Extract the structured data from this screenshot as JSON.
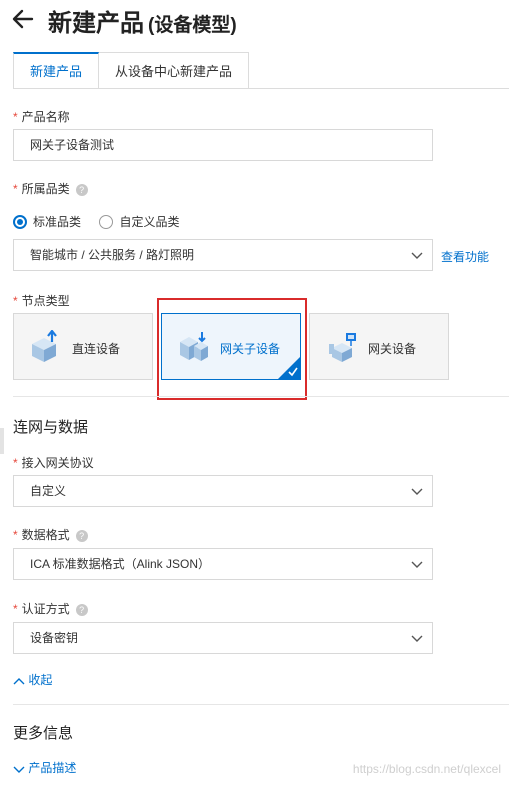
{
  "header": {
    "title": "新建产品",
    "subtitle": "(设备模型)"
  },
  "tabs": [
    {
      "label": "新建产品"
    },
    {
      "label": "从设备中心新建产品"
    }
  ],
  "form": {
    "product_name": {
      "label": "产品名称",
      "value": "网关子设备测试"
    },
    "category": {
      "label": "所属品类",
      "options": [
        {
          "label": "标准品类",
          "selected": true
        },
        {
          "label": "自定义品类",
          "selected": false
        }
      ],
      "select_value": "智能城市 / 公共服务 / 路灯照明",
      "link": "查看功能"
    },
    "node_type": {
      "label": "节点类型",
      "cards": [
        {
          "label": "直连设备",
          "selected": false
        },
        {
          "label": "网关子设备",
          "selected": true
        },
        {
          "label": "网关设备",
          "selected": false
        }
      ]
    }
  },
  "network": {
    "title": "连网与数据",
    "protocol": {
      "label": "接入网关协议",
      "value": "自定义"
    },
    "data_format": {
      "label": "数据格式",
      "value": "ICA 标准数据格式（Alink JSON）"
    },
    "auth": {
      "label": "认证方式",
      "value": "设备密钥"
    },
    "collapse": "收起"
  },
  "more": {
    "title": "更多信息",
    "desc_toggle": "产品描述"
  },
  "watermark": "https://blog.csdn.net/qlexcel",
  "colors": {
    "accent": "#0070cc",
    "required": "#e6483c",
    "highlight_box": "#d92b2b"
  },
  "icons": {
    "help": "?"
  }
}
